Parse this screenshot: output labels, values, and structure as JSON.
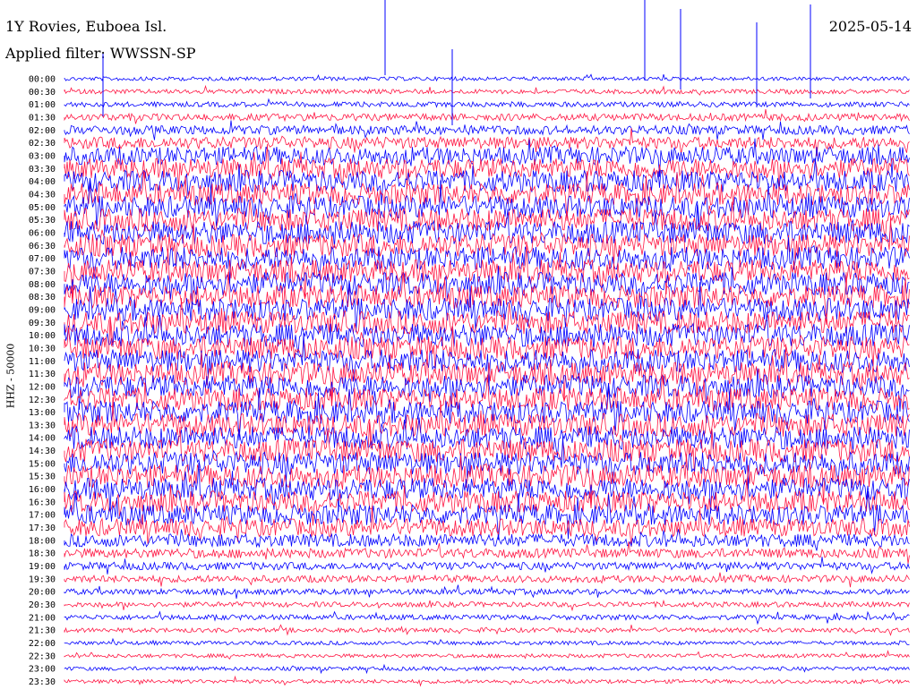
{
  "header": {
    "station": "1Y Rovies, Euboea Isl.",
    "filter": "Applied filter: WWSSN-SP",
    "date": "2025-05-14"
  },
  "chart_data": {
    "type": "line",
    "title": "1Y Rovies, Euboea Isl.",
    "subtitle": "Applied filter: WWSSN-SP",
    "date": "2025-05-14",
    "ylabel": "HHZ - 50000",
    "xlabel": "",
    "grid": false,
    "row_labels": [
      "00:00",
      "00:30",
      "01:00",
      "01:30",
      "02:00",
      "02:30",
      "03:00",
      "03:30",
      "04:00",
      "04:30",
      "05:00",
      "05:30",
      "06:00",
      "06:30",
      "07:00",
      "07:30",
      "08:00",
      "08:30",
      "09:00",
      "09:30",
      "10:00",
      "10:30",
      "11:00",
      "11:30",
      "12:00",
      "12:30",
      "13:00",
      "13:30",
      "14:00",
      "14:30",
      "15:00",
      "15:30",
      "16:00",
      "16:30",
      "17:00",
      "17:30",
      "18:00",
      "18:30",
      "19:00",
      "19:30",
      "20:00",
      "20:30",
      "21:00",
      "21:30",
      "22:00",
      "22:30",
      "23:00",
      "23:30"
    ],
    "relative_amplitude": [
      0.3,
      0.35,
      0.4,
      0.55,
      0.7,
      0.95,
      1.4,
      1.6,
      1.7,
      1.7,
      1.75,
      1.8,
      1.8,
      1.8,
      1.8,
      1.8,
      1.8,
      1.8,
      1.8,
      1.8,
      1.8,
      1.8,
      1.8,
      1.8,
      1.8,
      1.8,
      1.8,
      1.8,
      1.8,
      1.8,
      1.8,
      1.8,
      1.75,
      1.7,
      1.6,
      1.4,
      1.0,
      0.75,
      0.6,
      0.55,
      0.45,
      0.4,
      0.4,
      0.35,
      0.3,
      0.3,
      0.3,
      0.3
    ],
    "colors": [
      "#0000ff",
      "#ff1744"
    ]
  }
}
